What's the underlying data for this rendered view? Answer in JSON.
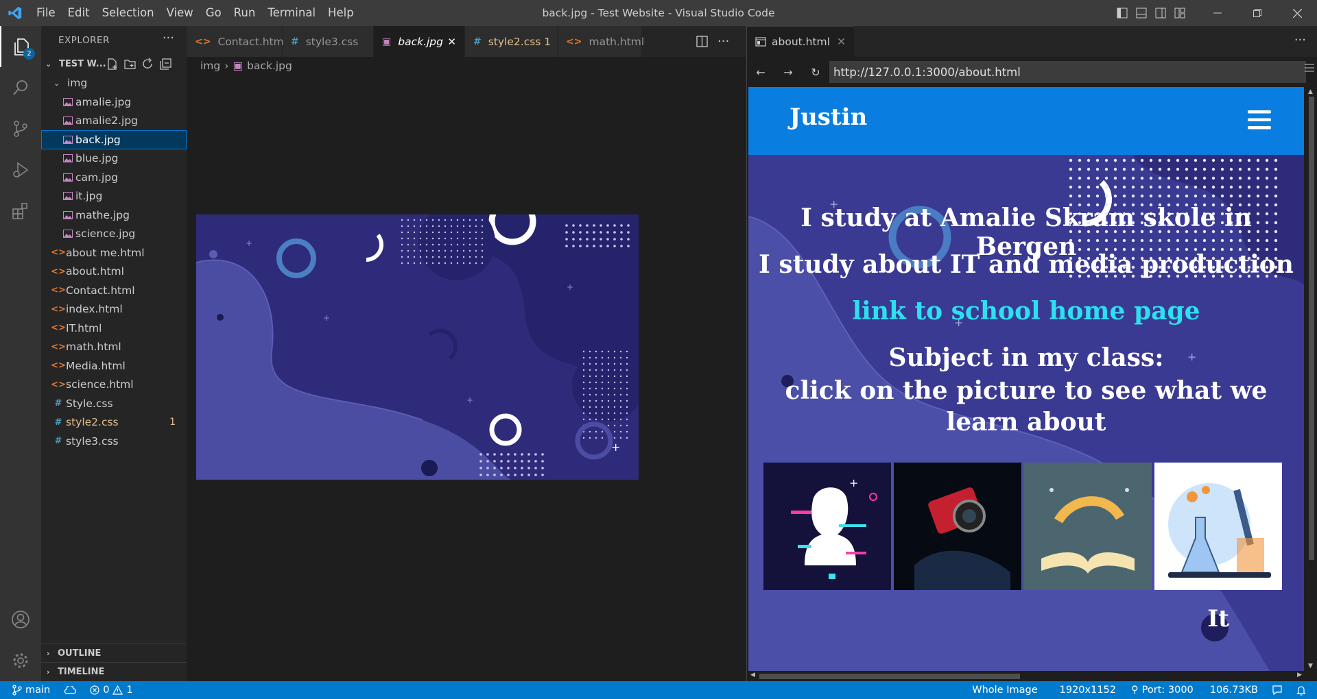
{
  "window": {
    "title": "back.jpg - Test Website - Visual Studio Code"
  },
  "menu": [
    "File",
    "Edit",
    "Selection",
    "View",
    "Go",
    "Run",
    "Terminal",
    "Help"
  ],
  "activity": {
    "explorer_badge": "2"
  },
  "explorer": {
    "title": "EXPLORER",
    "project": "TEST W...",
    "folder": "img",
    "images": [
      "amalie.jpg",
      "amalie2.jpg",
      "back.jpg",
      "blue.jpg",
      "cam.jpg",
      "it.jpg",
      "mathe.jpg",
      "science.jpg"
    ],
    "selected": "back.jpg",
    "html_files": [
      "about me.html",
      "about.html",
      "Contact.html",
      "index.html",
      "IT.html",
      "math.html",
      "Media.html",
      "science.html"
    ],
    "css_files": [
      {
        "name": "Style.css",
        "badge": ""
      },
      {
        "name": "style2.css",
        "badge": "1"
      },
      {
        "name": "style3.css",
        "badge": ""
      }
    ],
    "outline_label": "OUTLINE",
    "timeline_label": "TIMELINE"
  },
  "tabs": [
    {
      "label": "Contact.html",
      "kind": "html",
      "active": false
    },
    {
      "label": "style3.css",
      "kind": "css",
      "active": false
    },
    {
      "label": "back.jpg",
      "kind": "img",
      "active": true
    },
    {
      "label": "style2.css 1",
      "kind": "css",
      "active": false
    },
    {
      "label": "math.html",
      "kind": "html",
      "active": false
    }
  ],
  "breadcrumb": {
    "folder": "img",
    "file": "back.jpg"
  },
  "browser": {
    "tab_label": "about.html",
    "url": "http://127.0.0.1:3000/about.html",
    "site": {
      "brand": "Justin",
      "line1": "I study at Amalie Skram skole in Bergen",
      "line2": "I study about IT and media production",
      "link": "link to school home page",
      "line3": "Subject in my class:",
      "line4": "click on the picture to see what we learn about",
      "caption": "It"
    }
  },
  "status": {
    "branch": "main",
    "errors": "0",
    "warnings": "1",
    "image_mode": "Whole Image",
    "dimensions": "1920x1152",
    "port": "Port: 3000",
    "size": "106.73KB"
  },
  "colors": {
    "status_bar": "#007acc",
    "accent": "#0078d4",
    "site_nav": "#0a7ee0",
    "link": "#2ce0f0"
  }
}
